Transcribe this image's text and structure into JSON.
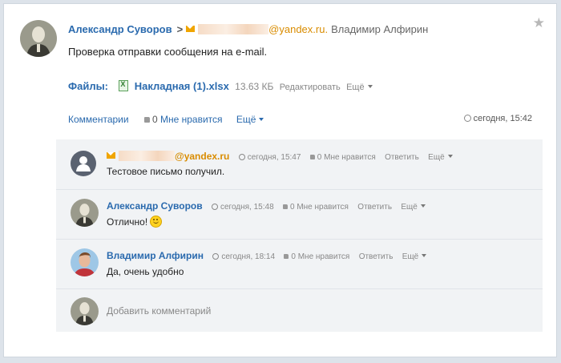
{
  "post": {
    "author": "Александр Суворов",
    "arrow": ">",
    "email_domain": "@yandex.ru.",
    "recipient": "Владимир Алфирин",
    "body": "Проверка отправки сообщения на e-mail.",
    "star_icon": "★"
  },
  "files": {
    "label": "Файлы:",
    "file_name": "Накладная (1).xlsx",
    "file_size": "13.63 КБ",
    "edit_label": "Редактировать",
    "more_label": "Ещё"
  },
  "actions": {
    "comments_label": "Комментарии",
    "like_count": "0",
    "like_label": "Мне нравится",
    "more_label": "Ещё",
    "time": "сегодня, 15:42"
  },
  "comments": [
    {
      "author": "@yandex.ru",
      "time": "сегодня, 15:47",
      "like_count": "0",
      "like_label": "Мне нравится",
      "reply_label": "Ответить",
      "more_label": "Ещё",
      "text": "Тестовое письмо получил."
    },
    {
      "author": "Александр Суворов",
      "time": "сегодня, 15:48",
      "like_count": "0",
      "like_label": "Мне нравится",
      "reply_label": "Ответить",
      "more_label": "Ещё",
      "text": "Отлично!"
    },
    {
      "author": "Владимир Алфирин",
      "time": "сегодня, 18:14",
      "like_count": "0",
      "like_label": "Мне нравится",
      "reply_label": "Ответить",
      "more_label": "Ещё",
      "text": "Да, очень удобно"
    }
  ],
  "add_comment": {
    "placeholder": "Добавить комментарий"
  },
  "colors": {
    "link": "#2a6aae",
    "email": "#d98c00",
    "background": "#dde3ea",
    "comments_bg": "#f1f3f5"
  }
}
